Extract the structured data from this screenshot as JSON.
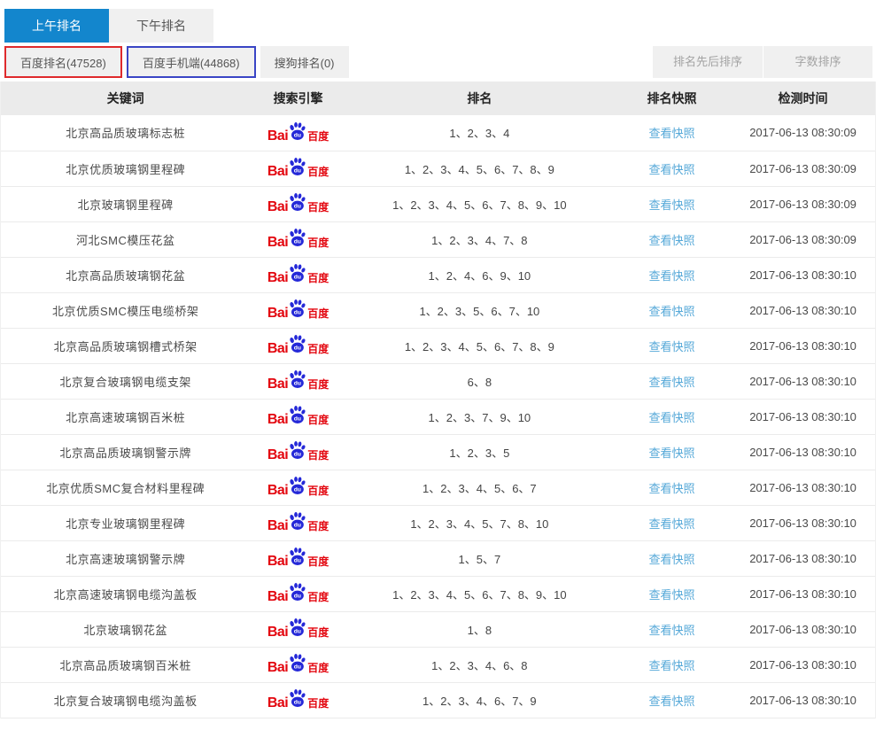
{
  "tabs": {
    "morning": "上午排名",
    "afternoon": "下午排名"
  },
  "subtabs": {
    "baidu_pc": "百度排名(47528)",
    "baidu_mobile": "百度手机端(44868)",
    "sogou": "搜狗排名(0)"
  },
  "sort_buttons": {
    "by_rank": "排名先后排序",
    "by_words": "字数排序"
  },
  "baidu_logo": {
    "bai": "Bai",
    "du": "du",
    "cn": "百度"
  },
  "colors": {
    "active_tab_blue": "#1386cd",
    "pc_tab_border_red": "#df2a2c",
    "mobile_tab_border_blue": "#3a45c5",
    "snapshot_link_blue": "#55a8d8",
    "baidu_red": "#e3060f",
    "baidu_paw_blue": "#2428d8",
    "header_bg": "#ebebeb",
    "inactive_bg": "#f0f0f0"
  },
  "table": {
    "headers": [
      "关键词",
      "搜索引擎",
      "排名",
      "排名快照",
      "检测时间"
    ],
    "snapshot_link_label": "查看快照",
    "search_engine_name": "百度",
    "rows": [
      {
        "keyword": "北京高品质玻璃标志桩",
        "rankings": "1、2、3、4",
        "check_time": "2017-06-13 08:30:09"
      },
      {
        "keyword": "北京优质玻璃钢里程碑",
        "rankings": "1、2、3、4、5、6、7、8、9",
        "check_time": "2017-06-13 08:30:09"
      },
      {
        "keyword": "北京玻璃钢里程碑",
        "rankings": "1、2、3、4、5、6、7、8、9、10",
        "check_time": "2017-06-13 08:30:09"
      },
      {
        "keyword": "河北SMC模压花盆",
        "rankings": "1、2、3、4、7、8",
        "check_time": "2017-06-13 08:30:09"
      },
      {
        "keyword": "北京高品质玻璃钢花盆",
        "rankings": "1、2、4、6、9、10",
        "check_time": "2017-06-13 08:30:10"
      },
      {
        "keyword": "北京优质SMC模压电缆桥架",
        "rankings": "1、2、3、5、6、7、10",
        "check_time": "2017-06-13 08:30:10"
      },
      {
        "keyword": "北京高品质玻璃钢槽式桥架",
        "rankings": "1、2、3、4、5、6、7、8、9",
        "check_time": "2017-06-13 08:30:10"
      },
      {
        "keyword": "北京复合玻璃钢电缆支架",
        "rankings": "6、8",
        "check_time": "2017-06-13 08:30:10"
      },
      {
        "keyword": "北京高速玻璃钢百米桩",
        "rankings": "1、2、3、7、9、10",
        "check_time": "2017-06-13 08:30:10"
      },
      {
        "keyword": "北京高品质玻璃钢警示牌",
        "rankings": "1、2、3、5",
        "check_time": "2017-06-13 08:30:10"
      },
      {
        "keyword": "北京优质SMC复合材料里程碑",
        "rankings": "1、2、3、4、5、6、7",
        "check_time": "2017-06-13 08:30:10"
      },
      {
        "keyword": "北京专业玻璃钢里程碑",
        "rankings": "1、2、3、4、5、7、8、10",
        "check_time": "2017-06-13 08:30:10"
      },
      {
        "keyword": "北京高速玻璃钢警示牌",
        "rankings": "1、5、7",
        "check_time": "2017-06-13 08:30:10"
      },
      {
        "keyword": "北京高速玻璃钢电缆沟盖板",
        "rankings": "1、2、3、4、5、6、7、8、9、10",
        "check_time": "2017-06-13 08:30:10"
      },
      {
        "keyword": "北京玻璃钢花盆",
        "rankings": "1、8",
        "check_time": "2017-06-13 08:30:10"
      },
      {
        "keyword": "北京高品质玻璃钢百米桩",
        "rankings": "1、2、3、4、6、8",
        "check_time": "2017-06-13 08:30:10"
      },
      {
        "keyword": "北京复合玻璃钢电缆沟盖板",
        "rankings": "1、2、3、4、6、7、9",
        "check_time": "2017-06-13 08:30:10"
      }
    ]
  }
}
